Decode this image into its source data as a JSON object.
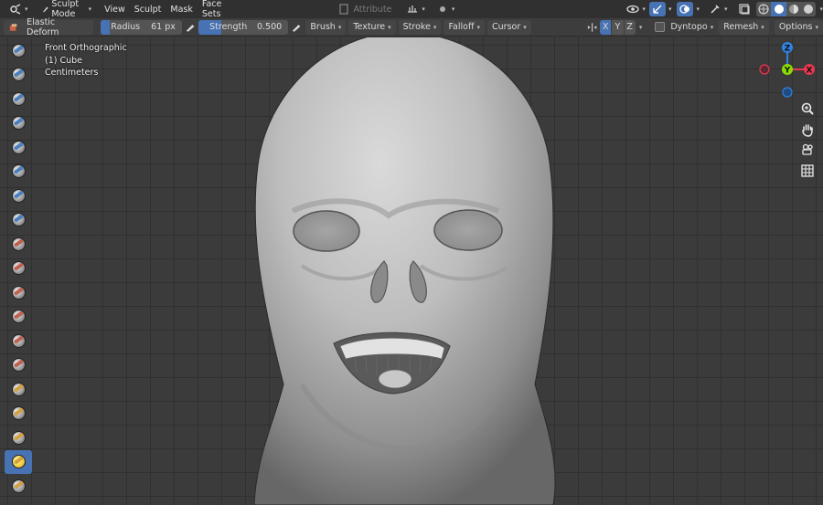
{
  "header": {
    "mode_label": "Sculpt Mode",
    "menus": [
      "View",
      "Sculpt",
      "Mask",
      "Face Sets"
    ],
    "attribute_label": "Attribute"
  },
  "toolbar": {
    "tool_name": "Elastic Deform",
    "radius_label": "Radius",
    "radius_value": "61 px",
    "strength_label": "Strength",
    "strength_value": "0.500",
    "strength_fraction": 0.5,
    "dropdowns": [
      "Brush",
      "Texture",
      "Stroke",
      "Falloff",
      "Cursor"
    ],
    "axes": [
      "X",
      "Y",
      "Z"
    ],
    "dyntopo_label": "Dyntopo",
    "remesh_label": "Remesh",
    "options_label": "Options"
  },
  "viewport": {
    "view_name": "Front Orthographic",
    "object_name": "(1) Cube",
    "units": "Centimeters"
  },
  "gizmo": {
    "z": "Z",
    "y": "Y",
    "x": "X"
  },
  "palette": {
    "active_index": 17,
    "tools": [
      "draw-brush-icon",
      "draw-sharp-icon",
      "clay-icon",
      "clay-strips-icon",
      "clay-thumb-icon",
      "layer-icon",
      "inflate-icon",
      "blob-icon",
      "crease-icon",
      "smooth-icon",
      "flatten-icon",
      "fill-icon",
      "scrape-icon",
      "multiplane-scrape-icon",
      "pinch-icon",
      "grab-icon",
      "elastic-deform-icon",
      "snake-hook-icon",
      "thumb-icon"
    ]
  },
  "colors": {
    "accent": "#4772b3",
    "axis_x": "#e8384f",
    "axis_y": "#8bdc00",
    "axis_z": "#2f83e3"
  }
}
